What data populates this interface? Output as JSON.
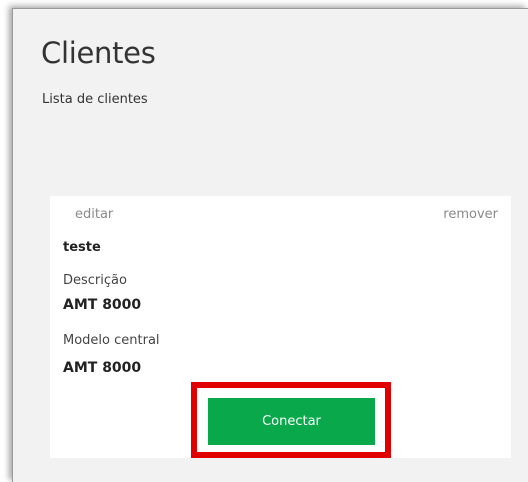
{
  "page": {
    "title": "Clientes",
    "subtitle": "Lista de clientes"
  },
  "client_card": {
    "edit_label": "editar",
    "remove_label": "remover",
    "name": "teste",
    "fields": [
      {
        "label": "Descrição",
        "value": "AMT 8000"
      },
      {
        "label": "Modelo central",
        "value": "AMT 8000"
      }
    ],
    "connect_label": "Conectar"
  },
  "colors": {
    "connect_button": "#09a84a",
    "highlight": "#e00000",
    "background": "#f2f2f2"
  }
}
